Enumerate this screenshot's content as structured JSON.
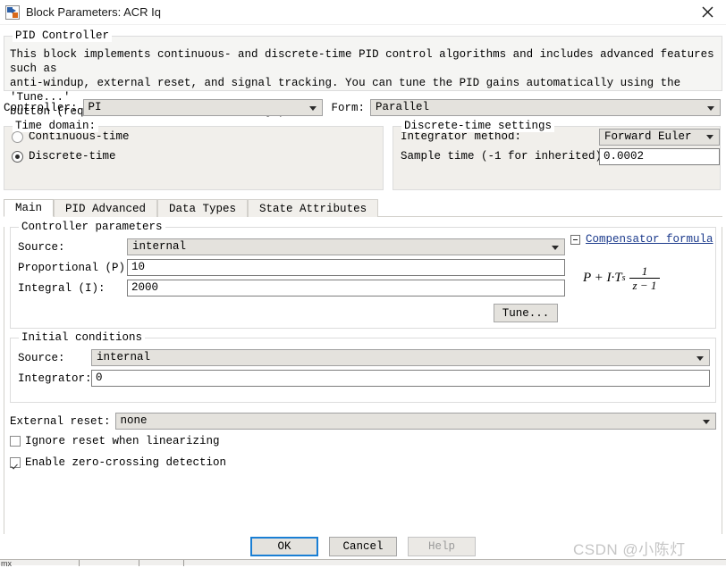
{
  "window": {
    "title": "Block Parameters: ACR Iq",
    "icon": "simulink-block-icon",
    "close_icon": "close-icon"
  },
  "description_group": {
    "legend": "PID Controller",
    "text": "This block implements continuous- and discrete-time PID control algorithms and includes advanced features such as\nanti-windup, external reset, and signal tracking. You can tune the PID gains automatically using the 'Tune...'\nbutton (requires Simulink Control Design)."
  },
  "controller_row": {
    "controller_label": "Controller:",
    "controller_value": "PI",
    "form_label": "Form:",
    "form_value": "Parallel"
  },
  "time_domain": {
    "legend": "Time domain:",
    "options": [
      {
        "label": "Continuous-time",
        "selected": false
      },
      {
        "label": "Discrete-time",
        "selected": true
      }
    ]
  },
  "discrete_settings": {
    "legend": "Discrete-time settings",
    "integrator_method_label": "Integrator method:",
    "integrator_method_value": "Forward Euler",
    "sample_time_label": "Sample time (-1 for inherited):",
    "sample_time_value": "0.0002"
  },
  "tabs": [
    {
      "label": "Main",
      "active": true
    },
    {
      "label": "PID Advanced",
      "active": false
    },
    {
      "label": "Data Types",
      "active": false
    },
    {
      "label": "State Attributes",
      "active": false
    }
  ],
  "controller_parameters": {
    "legend": "Controller parameters",
    "source_label": "Source:",
    "source_value": "internal",
    "proportional_label": "Proportional (P):",
    "proportional_value": "10",
    "integral_label": "Integral (I):",
    "integral_value": "2000",
    "tune_button": "Tune..."
  },
  "compensator": {
    "link_label": "Compensator formula",
    "formula": {
      "lead": "P + I·T",
      "lead_sub": "s",
      "numerator": "1",
      "denominator": "z − 1"
    }
  },
  "initial_conditions": {
    "legend": "Initial conditions",
    "source_label": "Source:",
    "source_value": "internal",
    "integrator_label": "Integrator:",
    "integrator_value": "0"
  },
  "external_reset": {
    "label": "External reset:",
    "value": "none"
  },
  "checkboxes": [
    {
      "label": "Ignore reset when linearizing",
      "checked": false
    },
    {
      "label": "Enable zero-crossing detection",
      "checked": true
    }
  ],
  "buttons": {
    "ok": "OK",
    "cancel": "Cancel",
    "help": "Help"
  },
  "footer": {
    "label": "mx"
  },
  "watermark": {
    "text": "CSDN @小陈灯"
  },
  "colors": {
    "focus_border": "#1a7fd4",
    "link": "#1b3a8c",
    "control_face": "#e4e2dd",
    "group_face": "#f1efeb",
    "desc_face": "#f5f5f3"
  }
}
